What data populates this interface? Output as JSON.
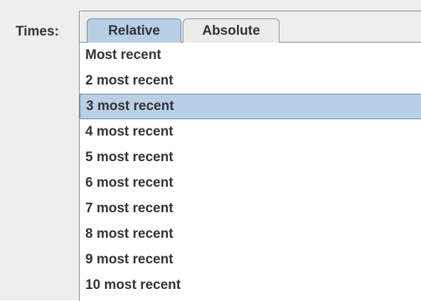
{
  "times_label": "Times:",
  "tabs": [
    {
      "label": "Relative",
      "active": true
    },
    {
      "label": "Absolute",
      "active": false
    }
  ],
  "list": {
    "selected_index": 2,
    "items": [
      "Most recent",
      "2 most recent",
      "3 most recent",
      "4 most recent",
      "5 most recent",
      "6 most recent",
      "7 most recent",
      "8 most recent",
      "9 most recent",
      "10 most recent"
    ]
  },
  "colors": {
    "panel_bg": "#eeeeee",
    "selection_bg": "#b8cfe5",
    "selection_border": "#6d8bb2",
    "text": "#333333"
  }
}
